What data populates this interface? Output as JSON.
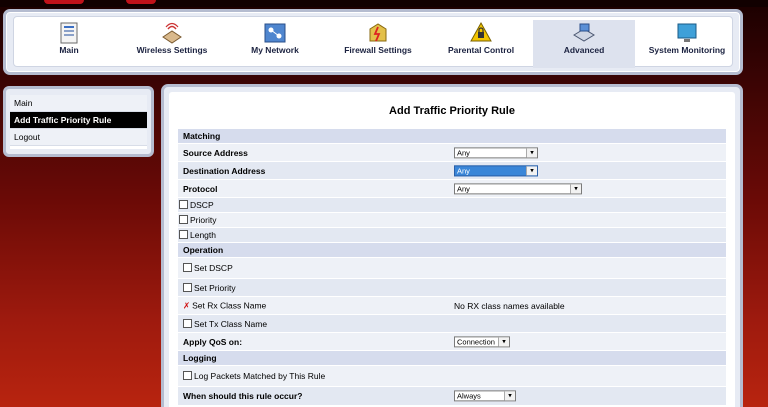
{
  "nav": {
    "items": [
      {
        "label": "Main",
        "icon": "main-icon"
      },
      {
        "label": "Wireless Settings",
        "icon": "wireless-icon"
      },
      {
        "label": "My Network",
        "icon": "network-icon"
      },
      {
        "label": "Firewall Settings",
        "icon": "firewall-icon"
      },
      {
        "label": "Parental Control",
        "icon": "lock-icon"
      },
      {
        "label": "Advanced",
        "icon": "advanced-icon"
      },
      {
        "label": "System Monitoring",
        "icon": "monitor-icon"
      }
    ],
    "active": "Advanced"
  },
  "sidebar": {
    "items": [
      {
        "label": "Main"
      },
      {
        "label": "Add Traffic Priority Rule"
      },
      {
        "label": "Logout"
      }
    ]
  },
  "page": {
    "title": "Add Traffic Priority Rule"
  },
  "form": {
    "matching": "Matching",
    "source_address": {
      "label": "Source Address",
      "value": "Any"
    },
    "destination_address": {
      "label": "Destination Address",
      "value": "Any"
    },
    "protocol": {
      "label": "Protocol",
      "value": "Any"
    },
    "dscp": "DSCP",
    "priority": "Priority",
    "length": "Length",
    "operation": "Operation",
    "set_dscp": "Set DSCP",
    "set_priority": "Set Priority",
    "set_rx_class": {
      "label": "Set Rx Class Name",
      "value": "No RX class names available"
    },
    "set_tx_class": "Set Tx Class Name",
    "apply_qos": {
      "label": "Apply QoS on:",
      "value": "Connection"
    },
    "logging": "Logging",
    "log_packets": "Log Packets Matched by This Rule",
    "when": {
      "label": "When should this rule occur?",
      "value": "Always"
    }
  },
  "colors": {
    "accent": "#3a86d8",
    "error": "#d01010",
    "row": "#eef1f7",
    "section": "#d6dced"
  }
}
